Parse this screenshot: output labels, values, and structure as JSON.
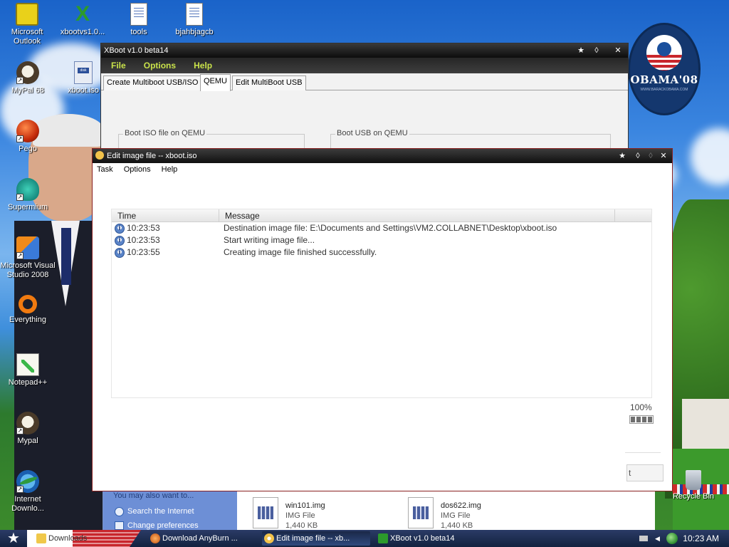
{
  "desktop": {
    "icons": [
      {
        "label": "Microsoft Outlook",
        "icon": "outlook-icon"
      },
      {
        "label": "xbootvs1.0...",
        "icon": "excel-icon"
      },
      {
        "label": "tools",
        "icon": "document-icon"
      },
      {
        "label": "bjahbjagcb",
        "icon": "document-icon"
      },
      {
        "label": "MyPal 68",
        "icon": "mypal-icon"
      },
      {
        "label": "xboot.iso",
        "icon": "iso-file-icon"
      },
      {
        "label": "Pego",
        "icon": "pego-icon"
      },
      {
        "label": "Supermium",
        "icon": "supermium-icon"
      },
      {
        "label": "Microsoft Visual Studio 2008",
        "icon": "visual-studio-icon"
      },
      {
        "label": "Everything",
        "icon": "everything-icon"
      },
      {
        "label": "Notepad++",
        "icon": "notepadpp-icon"
      },
      {
        "label": "Mypal",
        "icon": "mypal-icon"
      },
      {
        "label": "Internet Downlo...",
        "icon": "internet-download-icon"
      },
      {
        "label": "Recycle Bin",
        "icon": "recycle-bin-icon"
      }
    ],
    "badge": {
      "title": "OBAMA'08",
      "sub": "WWW.BARACKOBAMA.COM"
    }
  },
  "xboot": {
    "title": "XBoot v1.0 beta14",
    "menu": [
      "File",
      "Options",
      "Help"
    ],
    "tabs": [
      "Create Multiboot USB/ISO",
      "QEMU",
      "Edit MultiBoot USB"
    ],
    "active_tab": "QEMU",
    "group_iso": "Boot ISO file on QEMU",
    "group_usb": "Boot USB on QEMU",
    "title_buttons": [
      "pin-icon",
      "restore-icon",
      "close-icon"
    ]
  },
  "editwin": {
    "title": "Edit image file -- xboot.iso",
    "menu": [
      "Task",
      "Options",
      "Help"
    ],
    "columns": [
      "Time",
      "Message"
    ],
    "rows": [
      {
        "time": "10:23:53",
        "message": "Destination image file:  E:\\Documents and Settings\\VM2.COLLABNET\\Desktop\\xboot.iso"
      },
      {
        "time": "10:23:53",
        "message": "Start writing image file..."
      },
      {
        "time": "10:23:55",
        "message": "Creating image file finished successfully."
      }
    ],
    "progress_text": "100%",
    "progress": 1.0,
    "button_partial": "t"
  },
  "explorer": {
    "task_header": "You may also want to...",
    "links": [
      "Search the Internet",
      "Change preferences"
    ],
    "files": [
      {
        "name": "win101.img",
        "type": "IMG File",
        "size": "1,440 KB"
      },
      {
        "name": "dos622.img",
        "type": "IMG File",
        "size": "1,440 KB"
      }
    ]
  },
  "taskbar": {
    "items": [
      {
        "label": "Downloads",
        "icon": "folder-icon"
      },
      {
        "label": "Download AnyBurn ...",
        "icon": "browser-icon"
      },
      {
        "label": "Edit image file -- xb...",
        "icon": "disc-icon"
      },
      {
        "label": "XBoot v1.0 beta14",
        "icon": "xboot-icon"
      }
    ],
    "clock": "10:23 AM"
  }
}
